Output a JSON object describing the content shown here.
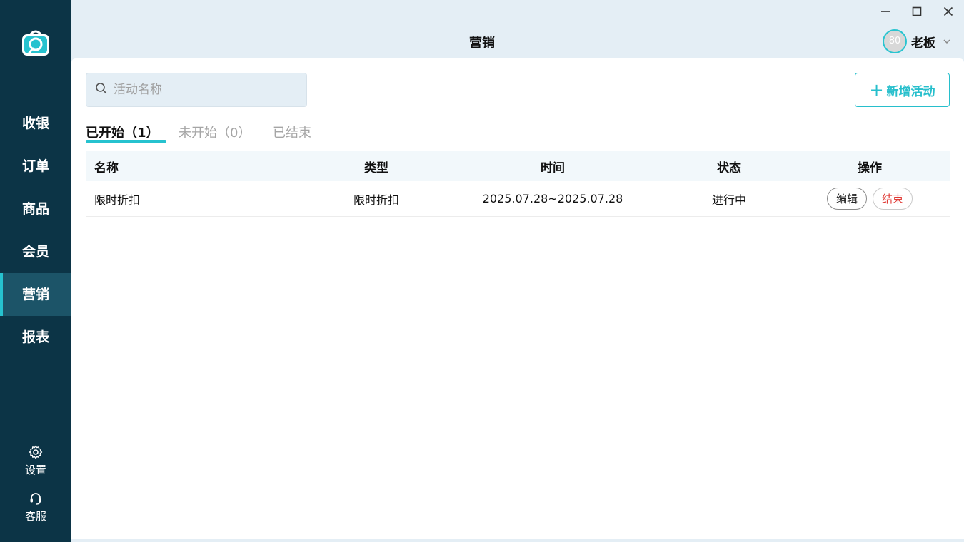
{
  "sidebar": {
    "logo_icon": "shopping-bag-logo-icon",
    "items": [
      {
        "label": "收银"
      },
      {
        "label": "订单"
      },
      {
        "label": "商品"
      },
      {
        "label": "会员"
      },
      {
        "label": "营销",
        "active": true
      },
      {
        "label": "报表"
      }
    ],
    "settings_label": "设置",
    "support_label": "客服"
  },
  "header": {
    "title": "营销",
    "user": {
      "avatar_text": "80",
      "name": "老板"
    },
    "window_controls": [
      "minimize-icon",
      "maximize-icon",
      "close-icon"
    ]
  },
  "toolbar": {
    "search_placeholder": "活动名称",
    "search_value": "",
    "add_label": "新增活动"
  },
  "tabs": [
    {
      "label": "已开始（1）",
      "active": true
    },
    {
      "label": "未开始（0）"
    },
    {
      "label": "已结束"
    }
  ],
  "table": {
    "columns": [
      "名称",
      "类型",
      "时间",
      "状态",
      "操作"
    ],
    "rows": [
      {
        "name": "限时折扣",
        "type": "限时折扣",
        "time": "2025.07.28~2025.07.28",
        "status": "进行中",
        "edit_label": "编辑",
        "end_label": "结束"
      }
    ]
  },
  "colors": {
    "sidebar_bg": "#0c3446",
    "sidebar_active": "#1c5468",
    "accent": "#26c2cf",
    "danger": "#e03a35",
    "header_bg": "#e4eef5"
  }
}
